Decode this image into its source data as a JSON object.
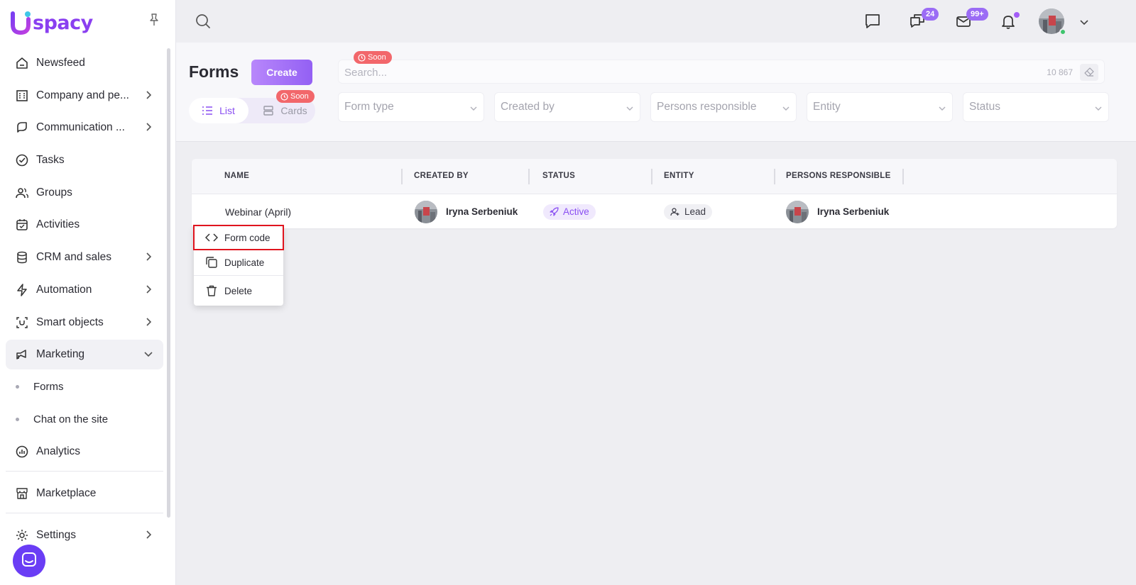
{
  "app": {
    "logo_text": "spacy"
  },
  "sidebar": {
    "items": [
      {
        "label": "Newsfeed",
        "icon": "home-icon",
        "chevron": false
      },
      {
        "label": "Company and pe...",
        "icon": "building-icon",
        "chevron": true
      },
      {
        "label": "Communication ...",
        "icon": "communication-icon",
        "chevron": true
      },
      {
        "label": "Tasks",
        "icon": "check-circle-icon",
        "chevron": false
      },
      {
        "label": "Groups",
        "icon": "users-icon",
        "chevron": false
      },
      {
        "label": "Activities",
        "icon": "calendar-icon",
        "chevron": false
      },
      {
        "label": "CRM and sales",
        "icon": "database-icon",
        "chevron": true
      },
      {
        "label": "Automation",
        "icon": "lightning-icon",
        "chevron": true
      },
      {
        "label": "Smart objects",
        "icon": "smart-object-icon",
        "chevron": true
      },
      {
        "label": "Marketing",
        "icon": "marketing-icon",
        "chevron": true,
        "open": true
      }
    ],
    "subitems": [
      {
        "label": "Forms"
      },
      {
        "label": "Chat on the site"
      }
    ],
    "bottom_items": [
      {
        "label": "Analytics",
        "icon": "analytics-icon"
      },
      {
        "label": "Marketplace",
        "icon": "store-icon"
      },
      {
        "label": "Settings",
        "icon": "gear-icon"
      }
    ]
  },
  "header": {
    "chat_badge": "24",
    "mail_badge": "99+"
  },
  "toolbar": {
    "title": "Forms",
    "create_label": "Create",
    "view_list_label": "List",
    "view_cards_label": "Cards",
    "soon_label": "Soon",
    "search_placeholder": "Search...",
    "search_count": "10 867",
    "filters": [
      "Form type",
      "Created by",
      "Persons responsible",
      "Entity",
      "Status"
    ]
  },
  "table": {
    "columns": [
      "NAME",
      "CREATED BY",
      "STATUS",
      "ENTITY",
      "PERSONS RESPONSIBLE"
    ],
    "rows": [
      {
        "name": "Webinar (April)",
        "created_by": "Iryna Serbeniuk",
        "status": "Active",
        "entity": "Lead",
        "persons_responsible": "Iryna Serbeniuk"
      }
    ]
  },
  "context_menu": {
    "items": [
      "Form code",
      "Duplicate",
      "Delete"
    ]
  },
  "colors": {
    "accent": "#8a4ff2",
    "create_gradient_start": "#b887fb",
    "create_gradient_end": "#9360f4",
    "soon_red": "#f2676b",
    "highlight_red": "#e0141e",
    "online_green": "#3ec46d"
  }
}
